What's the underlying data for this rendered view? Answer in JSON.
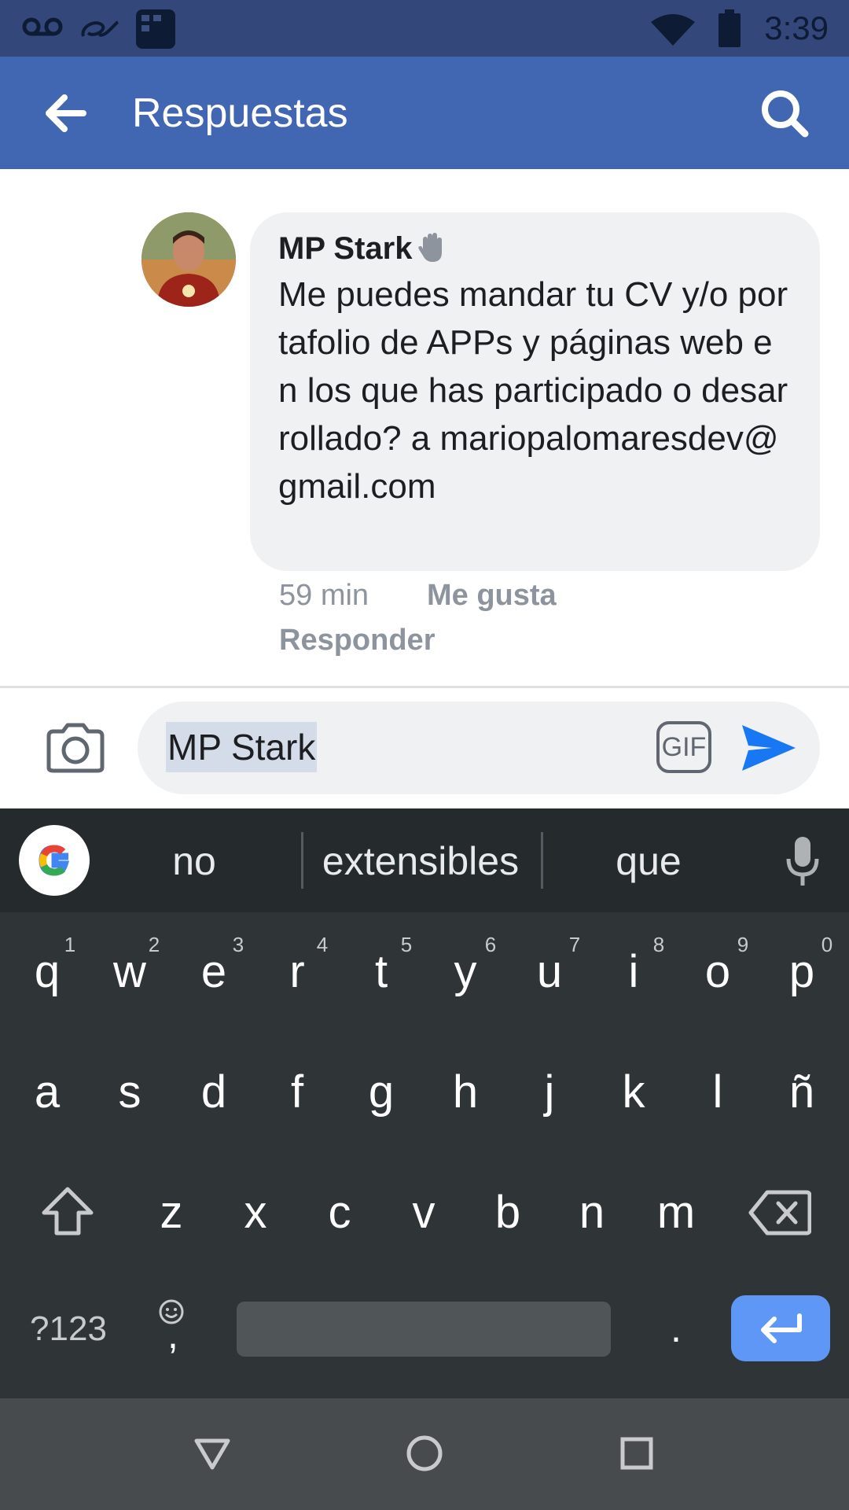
{
  "status_bar": {
    "time": "3:39"
  },
  "app_bar": {
    "title": "Respuestas",
    "back_icon": "arrow-left-icon",
    "search_icon": "search-icon"
  },
  "comment": {
    "author": "MP Stark",
    "body": "Me puedes mandar tu CV y/o portafolio de APPs y páginas web en los que has participado o desarrollado? a mariopalomaresdev@gmail.com",
    "time": "59 min",
    "like_label": "Me gusta",
    "reply_label": "Responder"
  },
  "composer": {
    "input_value": "MP Stark",
    "gif_label": "GIF"
  },
  "keyboard": {
    "suggestions": [
      "no",
      "extensibles",
      "que"
    ],
    "row1": [
      "q",
      "w",
      "e",
      "r",
      "t",
      "y",
      "u",
      "i",
      "o",
      "p"
    ],
    "row1_hints": [
      "1",
      "2",
      "3",
      "4",
      "5",
      "6",
      "7",
      "8",
      "9",
      "0"
    ],
    "row2": [
      "a",
      "s",
      "d",
      "f",
      "g",
      "h",
      "j",
      "k",
      "l",
      "ñ"
    ],
    "row3": [
      "z",
      "x",
      "c",
      "v",
      "b",
      "n",
      "m"
    ],
    "symbols_label": "?123",
    "comma_label": ",",
    "period_label": "."
  },
  "colors": {
    "app_bar": "#4267b2",
    "status_bar": "#33477a",
    "send": "#1877f2",
    "enter_key": "#5e97f6"
  }
}
